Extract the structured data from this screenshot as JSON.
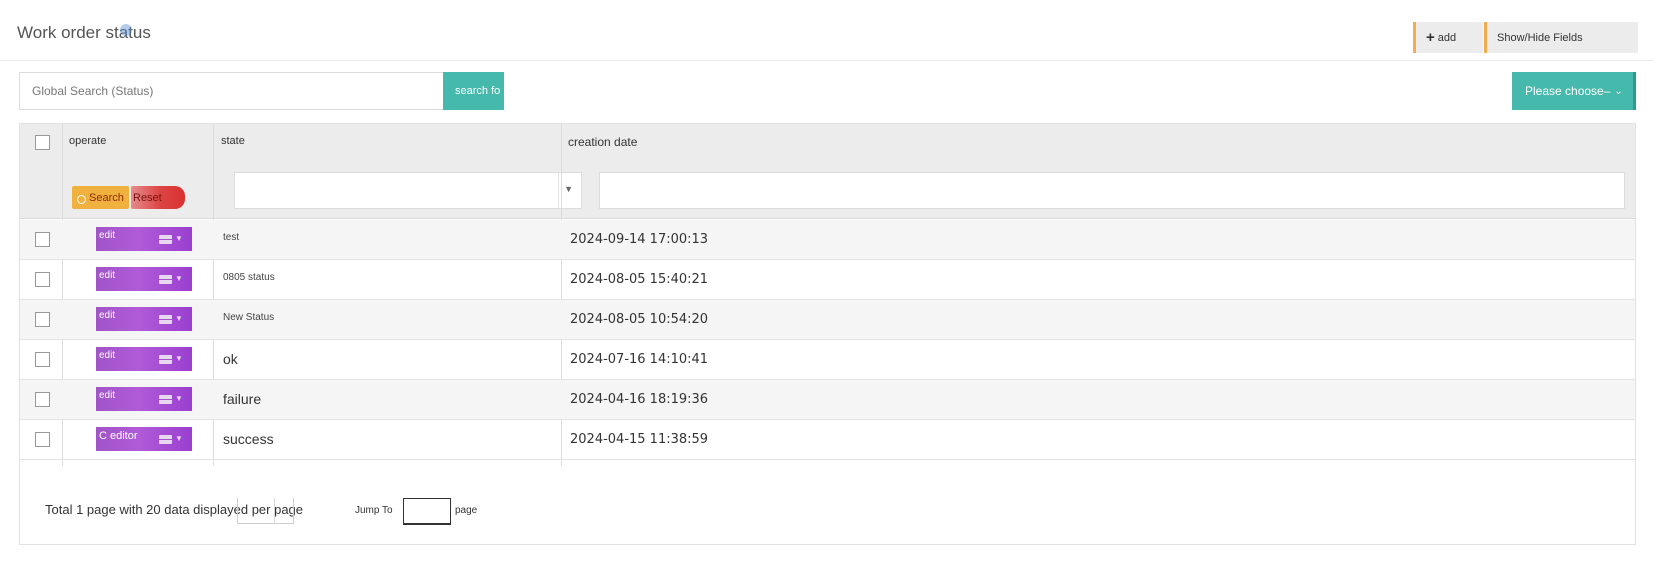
{
  "header": {
    "title": "Work order status",
    "add_label": "add",
    "fields_label": "Show/Hide Fields"
  },
  "toolbar": {
    "search_placeholder": "Global Search (Status)",
    "search_button": "search fo",
    "choose_label": "Please choose–"
  },
  "table": {
    "columns": {
      "operate": "operate",
      "state": "state",
      "creation_date": "creation date"
    },
    "filter": {
      "search_label": "Search",
      "reset_label": "Reset"
    },
    "rows": [
      {
        "action": "edit",
        "state": "test",
        "date": "2024-09-14 17:00:13"
      },
      {
        "action": "edit",
        "state": "0805 status",
        "date": "2024-08-05 15:40:21"
      },
      {
        "action": "edit",
        "state": "New Status",
        "date": "2024-08-05 10:54:20"
      },
      {
        "action": "edit",
        "state": "ok",
        "date": "2024-07-16 14:10:41"
      },
      {
        "action": "edit",
        "state": "failure",
        "date": "2024-04-16 18:19:36"
      },
      {
        "action": "C editor",
        "state": "success",
        "date": "2024-04-15 11:38:59"
      }
    ]
  },
  "footer": {
    "total_text": "Total 1 page with 20 data displayed per page",
    "jump_to": "Jump To",
    "page_label": "page"
  },
  "colors": {
    "teal": "#45b9ab",
    "purple": "#a055c8",
    "orange": "#f0b13f",
    "red": "#dd4444"
  },
  "icons": [
    "plus-icon",
    "caret-down-icon",
    "magnifier-icon",
    "menu-icon",
    "chevron-down-icon"
  ]
}
